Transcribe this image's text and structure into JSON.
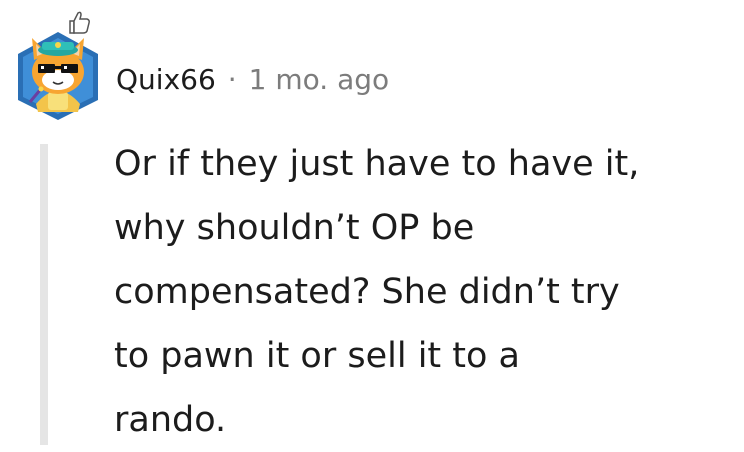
{
  "comment": {
    "author": "Quix66",
    "separator": "·",
    "timestamp": "1 mo. ago",
    "avatar": {
      "icon": "snoo-cat-avatar-icon",
      "badge_icon": "thumbs-up-icon",
      "colors": {
        "frame": "#2a6fb5",
        "head": "#f7a531",
        "glasses": "#111111"
      }
    },
    "body_lines": [
      "Or if they just have to have it,",
      "why shouldn’t OP be",
      "compensated? She didn’t try",
      "to pawn it or sell it to a",
      "rando."
    ]
  },
  "colors": {
    "text": "#1c1c1c",
    "meta": "#7c7c7c",
    "thread_line": "#e5e5e5"
  }
}
